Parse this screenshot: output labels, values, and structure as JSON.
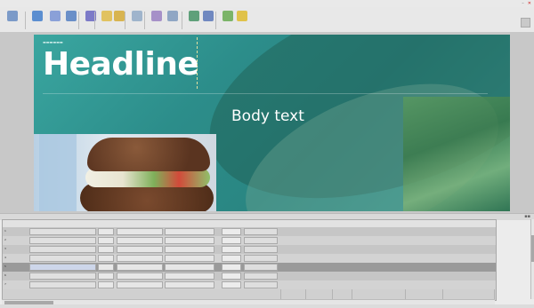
{
  "slide": {
    "headline": "Headline",
    "body_text": "Body text"
  },
  "grid": {
    "rows": [
      {
        "num": "1",
        "cellC": ""
      },
      {
        "num": "2",
        "cellC": ""
      },
      {
        "num": "3",
        "cellC": ""
      },
      {
        "num": "4",
        "cellC": ""
      },
      {
        "num": "5",
        "cellC": ""
      },
      {
        "num": "6",
        "cellC": ""
      },
      {
        "num": "7",
        "cellC": ""
      }
    ]
  },
  "colors": {
    "slide_teal": "#2c8d8a",
    "toolbar_bg": "#e8e8e8",
    "selected_row": "#9a9a9a",
    "selected_name_text": "#1c3c8c"
  },
  "icons": [
    "new-icon",
    "open-icon",
    "save-icon",
    "cut-icon",
    "copy-icon",
    "paste-icon",
    "text-icon",
    "image-icon",
    "layer-icon",
    "layout-icon",
    "style-icon",
    "export-icon",
    "preview-icon",
    "publish-icon",
    "close-icon"
  ]
}
